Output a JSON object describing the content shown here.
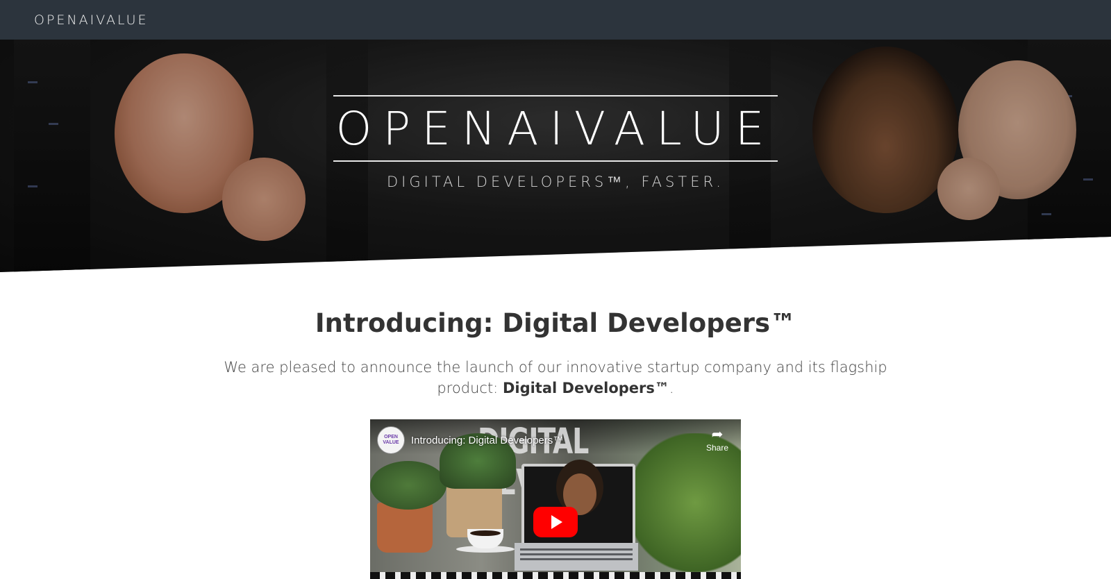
{
  "navbar": {
    "logo_text": "OPENAIVALUE",
    "background_color": "#2c343d"
  },
  "hero": {
    "title": "OPENAIVALUE",
    "tagline": "DIGITAL DEVELOPERS™, FASTER."
  },
  "intro": {
    "heading": "Introducing: Digital Developers™",
    "text_prefix": "We are pleased to announce the launch of our innovative startup company and its flagship product: ",
    "text_bold": "Digital Developers™",
    "text_suffix": "."
  },
  "video": {
    "title": "Introducing: Digital Developers™",
    "banner_text": "DIGITAL DEVELOPERS™",
    "channel_logo_text": "OPEN VALUE",
    "share_label": "Share",
    "share_icon": "share-arrow-icon",
    "play_icon": "play-icon",
    "play_color": "#ff0000"
  }
}
